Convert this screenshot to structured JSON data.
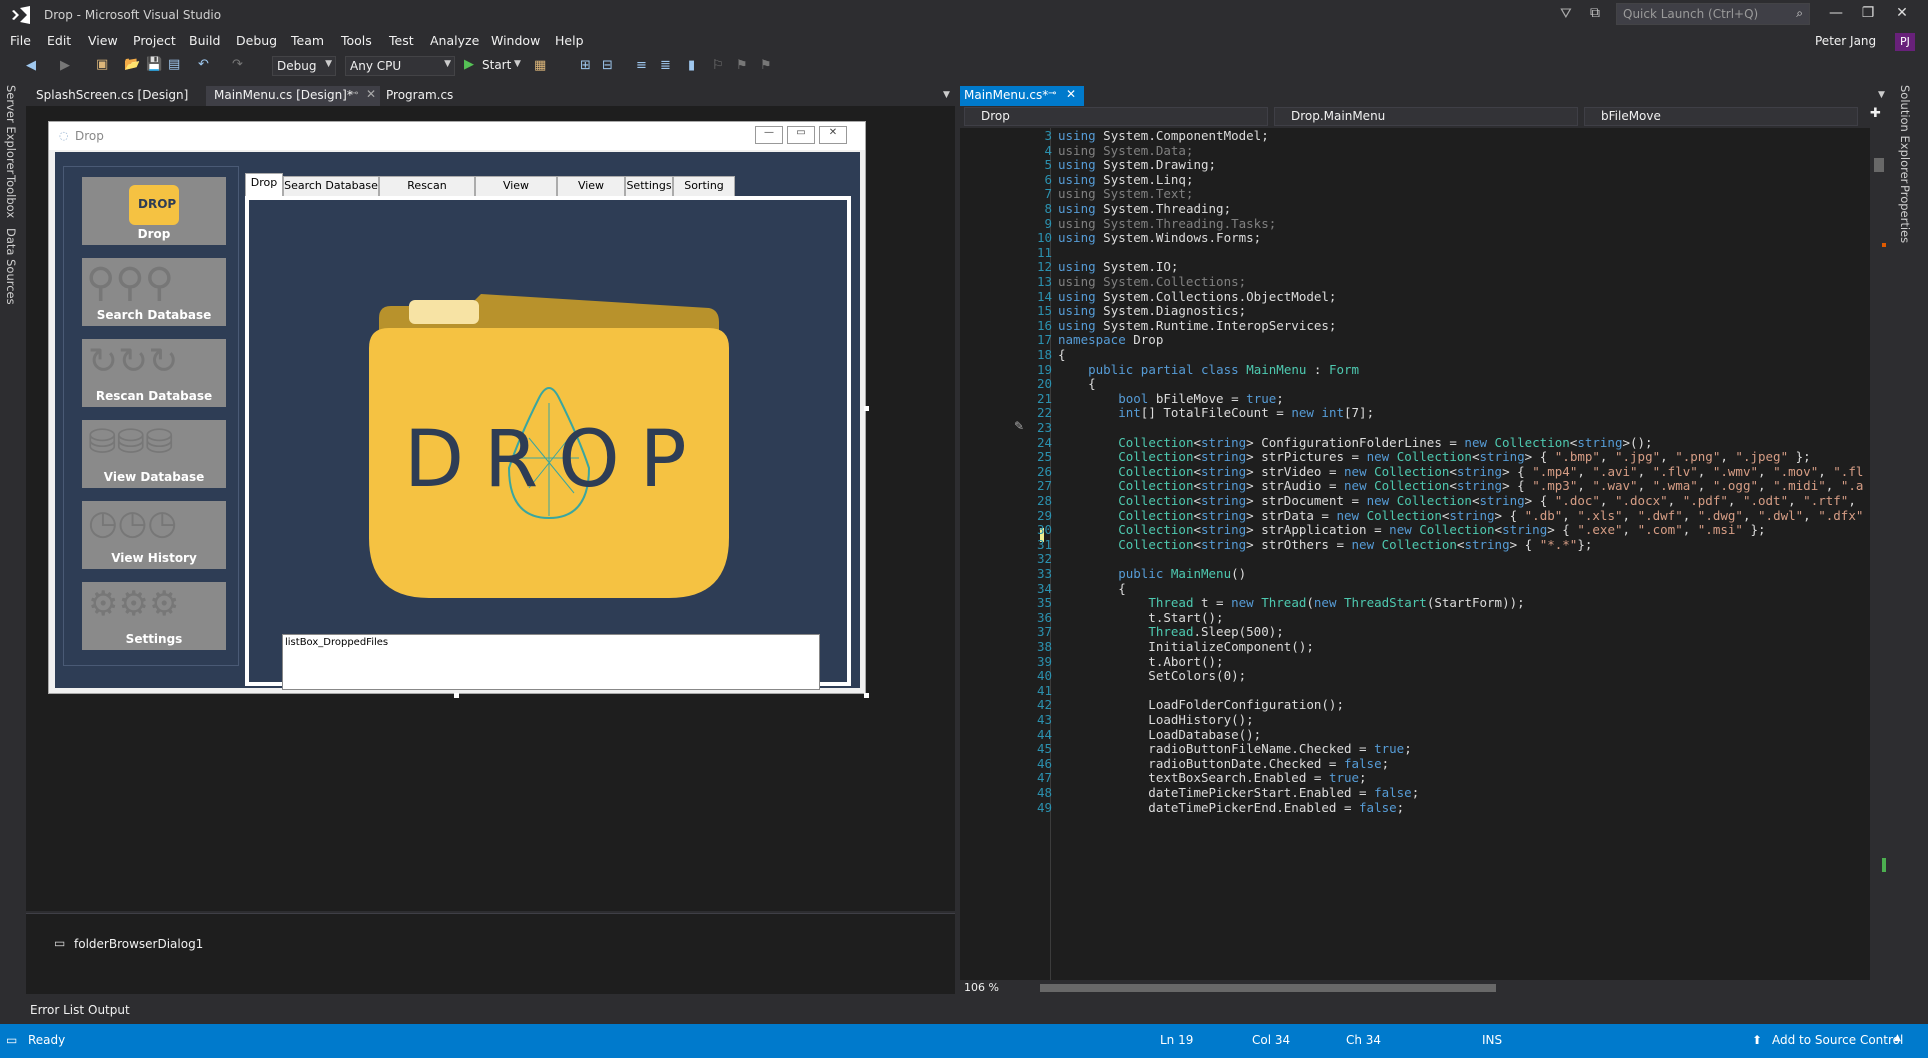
{
  "window": {
    "title": "Drop - Microsoft Visual Studio",
    "quick_launch_placeholder": "Quick Launch (Ctrl+Q)"
  },
  "menu": [
    "File",
    "Edit",
    "View",
    "Project",
    "Build",
    "Debug",
    "Team",
    "Tools",
    "Test",
    "Analyze",
    "Window",
    "Help"
  ],
  "user": {
    "name": "Peter Jang",
    "initials": "PJ"
  },
  "toolbar": {
    "config": "Debug",
    "platform": "Any CPU",
    "start": "Start"
  },
  "left_strip": [
    "Server Explorer",
    "Toolbox",
    "Data Sources"
  ],
  "right_strip": [
    "Solution Explorer",
    "Properties"
  ],
  "design_tabs": [
    "SplashScreen.cs [Design]",
    "MainMenu.cs [Design]*",
    "Program.cs"
  ],
  "form": {
    "title": "Drop",
    "side_buttons": [
      "Drop",
      "Search Database",
      "Rescan Database",
      "View Database",
      "View History",
      "Settings"
    ],
    "tabs": [
      "Drop",
      "Search Database",
      "Rescan Database",
      "View Database",
      "View History",
      "Settings",
      "Sorting test"
    ],
    "logo_text": "DROP",
    "listbox": "listBox_DroppedFiles"
  },
  "tray": {
    "component": "folderBrowserDialog1"
  },
  "bottom_tabs": [
    "Error List",
    "Output"
  ],
  "code_tab": "MainMenu.cs*",
  "navbar": {
    "project": "Drop",
    "class": "Drop.MainMenu",
    "member": "bFileMove"
  },
  "zoom": "106 %",
  "colors": {
    "accent": "#007acc",
    "form_bg": "#2e3d55",
    "folder": "#f5c242"
  },
  "code_lines": [
    {
      "n": "3",
      "t": "using System.ComponentModel;"
    },
    {
      "n": "4",
      "t": "using System.Data;"
    },
    {
      "n": "5",
      "t": "using System.Drawing;"
    },
    {
      "n": "6",
      "t": "using System.Linq;"
    },
    {
      "n": "7",
      "t": "using System.Text;"
    },
    {
      "n": "8",
      "t": "using System.Threading;"
    },
    {
      "n": "9",
      "t": "using System.Threading.Tasks;"
    },
    {
      "n": "10",
      "t": "using System.Windows.Forms;"
    },
    {
      "n": "11",
      "t": ""
    },
    {
      "n": "12",
      "t": "using System.IO;"
    },
    {
      "n": "13",
      "t": "using System.Collections;"
    },
    {
      "n": "14",
      "t": "using System.Collections.ObjectModel;"
    },
    {
      "n": "15",
      "t": "using System.Diagnostics;"
    },
    {
      "n": "16",
      "t": "using System.Runtime.InteropServices;"
    },
    {
      "n": "17",
      "t": "namespace Drop"
    },
    {
      "n": "18",
      "t": "{"
    },
    {
      "n": "19",
      "t": "    public partial class MainMenu : Form"
    },
    {
      "n": "20",
      "t": "    {"
    },
    {
      "n": "21",
      "t": "        bool bFileMove = true;"
    },
    {
      "n": "22",
      "t": "        int[] TotalFileCount = new int[7];"
    },
    {
      "n": "23",
      "t": ""
    },
    {
      "n": "24",
      "t": "        Collection<string> ConfigurationFolderLines = new Collection<string>();"
    },
    {
      "n": "25",
      "t": "        Collection<string> strPictures = new Collection<string> { \".bmp\", \".jpg\", \".png\", \".jpeg\" };"
    },
    {
      "n": "26",
      "t": "        Collection<string> strVideo = new Collection<string> { \".mp4\", \".avi\", \".flv\", \".wmv\", \".mov\", \".fl"
    },
    {
      "n": "27",
      "t": "        Collection<string> strAudio = new Collection<string> { \".mp3\", \".wav\", \".wma\", \".ogg\", \".midi\", \".a"
    },
    {
      "n": "28",
      "t": "        Collection<string> strDocument = new Collection<string> { \".doc\", \".docx\", \".pdf\", \".odt\", \".rtf\","
    },
    {
      "n": "29",
      "t": "        Collection<string> strData = new Collection<string> { \".db\", \".xls\", \".dwf\", \".dwg\", \".dwl\", \".dfx\""
    },
    {
      "n": "30",
      "t": "        Collection<string> strApplication = new Collection<string> { \".exe\", \".com\", \".msi\" };"
    },
    {
      "n": "31",
      "t": "        Collection<string> strOthers = new Collection<string> { \"*.*\"};"
    },
    {
      "n": "32",
      "t": ""
    },
    {
      "n": "33",
      "t": "        public MainMenu()"
    },
    {
      "n": "34",
      "t": "        {"
    },
    {
      "n": "35",
      "t": "            Thread t = new Thread(new ThreadStart(StartForm));"
    },
    {
      "n": "36",
      "t": "            t.Start();"
    },
    {
      "n": "37",
      "t": "            Thread.Sleep(500);"
    },
    {
      "n": "38",
      "t": "            InitializeComponent();"
    },
    {
      "n": "39",
      "t": "            t.Abort();"
    },
    {
      "n": "40",
      "t": "            SetColors(0);"
    },
    {
      "n": "41",
      "t": ""
    },
    {
      "n": "42",
      "t": "            LoadFolderConfiguration();"
    },
    {
      "n": "43",
      "t": "            LoadHistory();"
    },
    {
      "n": "44",
      "t": "            LoadDatabase();"
    },
    {
      "n": "45",
      "t": "            radioButtonFileName.Checked = true;"
    },
    {
      "n": "46",
      "t": "            radioButtonDate.Checked = false;"
    },
    {
      "n": "47",
      "t": "            textBoxSearch.Enabled = true;"
    },
    {
      "n": "48",
      "t": "            dateTimePickerStart.Enabled = false;"
    },
    {
      "n": "49",
      "t": "            dateTimePickerEnd.Enabled = false;"
    }
  ],
  "status": {
    "ready": "Ready",
    "ln": "Ln 19",
    "col": "Col 34",
    "ch": "Ch 34",
    "ins": "INS",
    "source_control": "Add to Source Control"
  }
}
